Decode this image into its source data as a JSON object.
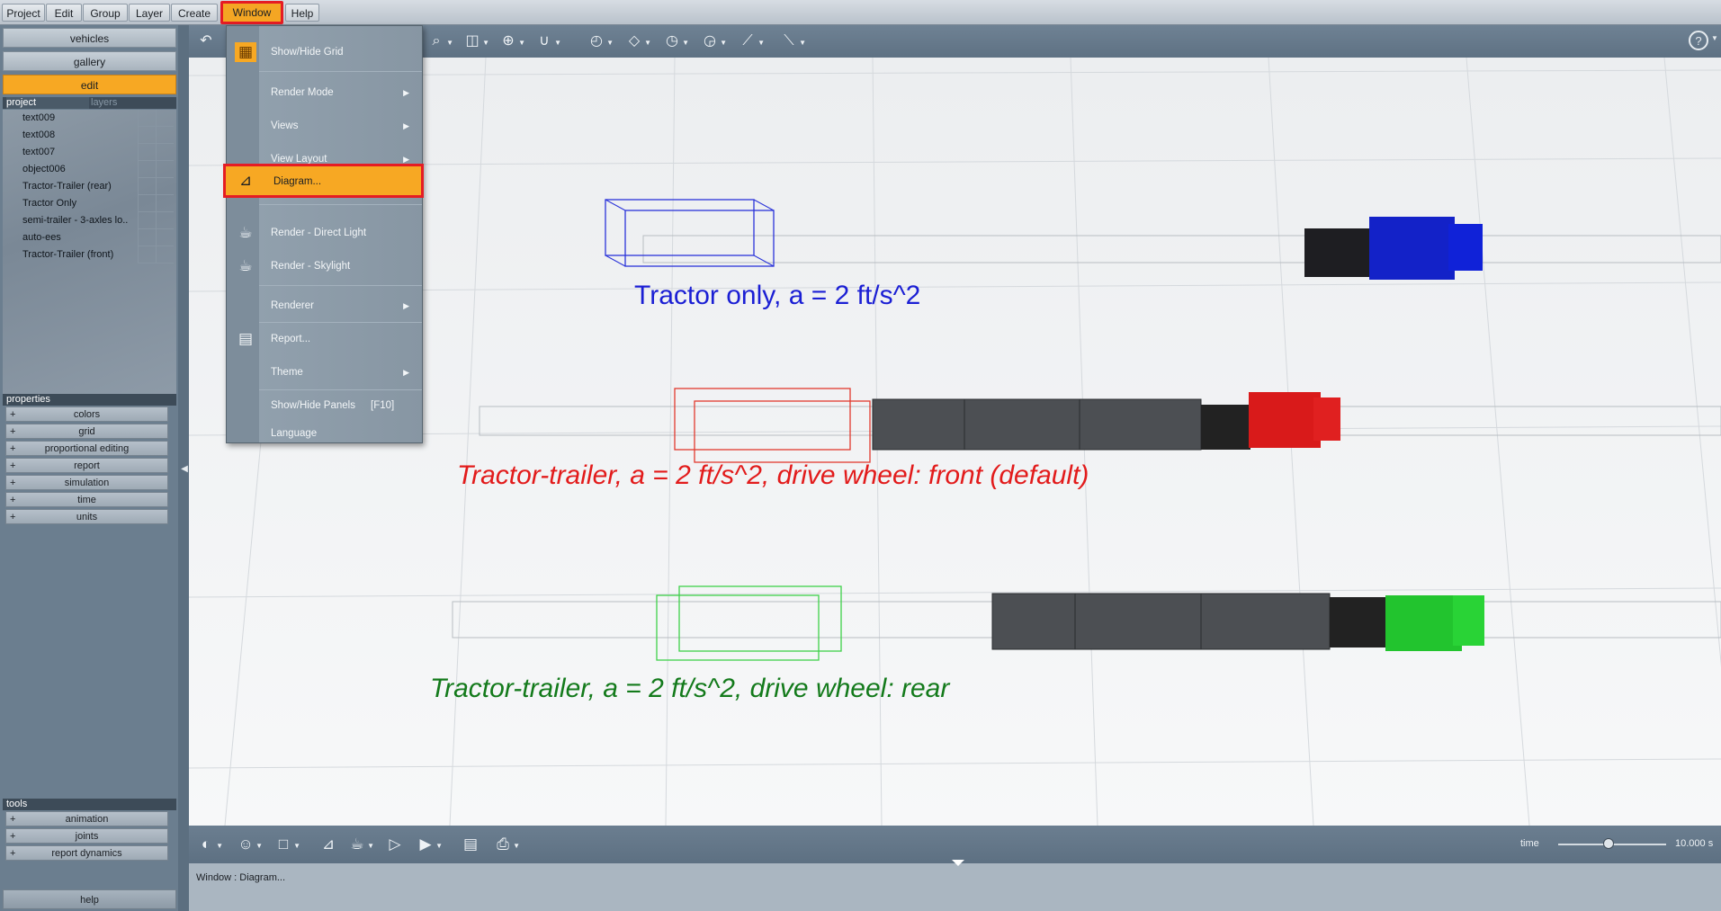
{
  "menubar": {
    "items": [
      "Project",
      "Edit",
      "Group",
      "Layer",
      "Create",
      "Window",
      "Help"
    ]
  },
  "left_panel": {
    "tabs": [
      "vehicles",
      "gallery",
      "edit"
    ],
    "project_tab": "project",
    "layers_tab": "layers",
    "project_items": [
      "text009",
      "text008",
      "text007",
      "object006",
      "Tractor-Trailer (rear)",
      "Tractor Only",
      "semi-trailer - 3-axles lo..",
      "auto-ees",
      "Tractor-Trailer (front)"
    ],
    "properties_header": "properties",
    "properties_items": [
      "colors",
      "grid",
      "proportional editing",
      "report",
      "simulation",
      "time",
      "units"
    ],
    "tools_header": "tools",
    "tools_items": [
      "animation",
      "joints",
      "report dynamics"
    ],
    "help_label": "help"
  },
  "window_menu": {
    "items": [
      {
        "label": "Show/Hide Grid",
        "icon": "grid-icon",
        "submenu": false
      },
      {
        "label": "Render Mode",
        "icon": "",
        "submenu": true
      },
      {
        "label": "Views",
        "icon": "",
        "submenu": true
      },
      {
        "label": "View Layout",
        "icon": "",
        "submenu": true
      },
      {
        "label": "Diagram...",
        "icon": "diagram-icon",
        "submenu": false,
        "highlighted": true
      },
      {
        "label": "Render - Direct Light",
        "icon": "teapot-icon",
        "submenu": false
      },
      {
        "label": "Render - Skylight",
        "icon": "teapot-icon",
        "submenu": false
      },
      {
        "label": "Renderer",
        "icon": "",
        "submenu": true
      },
      {
        "label": "Report...",
        "icon": "report-icon",
        "submenu": false
      },
      {
        "label": "Theme",
        "icon": "",
        "submenu": true
      },
      {
        "label": "Show/Hide Panels",
        "shortcut": "[F10]",
        "icon": "",
        "submenu": false
      },
      {
        "label": "Language",
        "icon": "",
        "submenu": false
      }
    ]
  },
  "viewport": {
    "captions": {
      "blue": "Tractor only, a = 2 ft/s^2",
      "red": "Tractor-trailer, a = 2 ft/s^2, drive wheel: front (default)",
      "green": "Tractor-trailer, a = 2 ft/s^2, drive wheel: rear"
    },
    "colors": {
      "blue": "#1b1fd4",
      "red": "#e21b1b",
      "green": "#137a1b"
    }
  },
  "bottom": {
    "time_label": "time",
    "time_value": "10.000 s",
    "time_fraction": 0.47,
    "status": "Window : Diagram..."
  },
  "colors": {
    "accent": "#f7a823",
    "highlight_border": "#e51c23"
  }
}
